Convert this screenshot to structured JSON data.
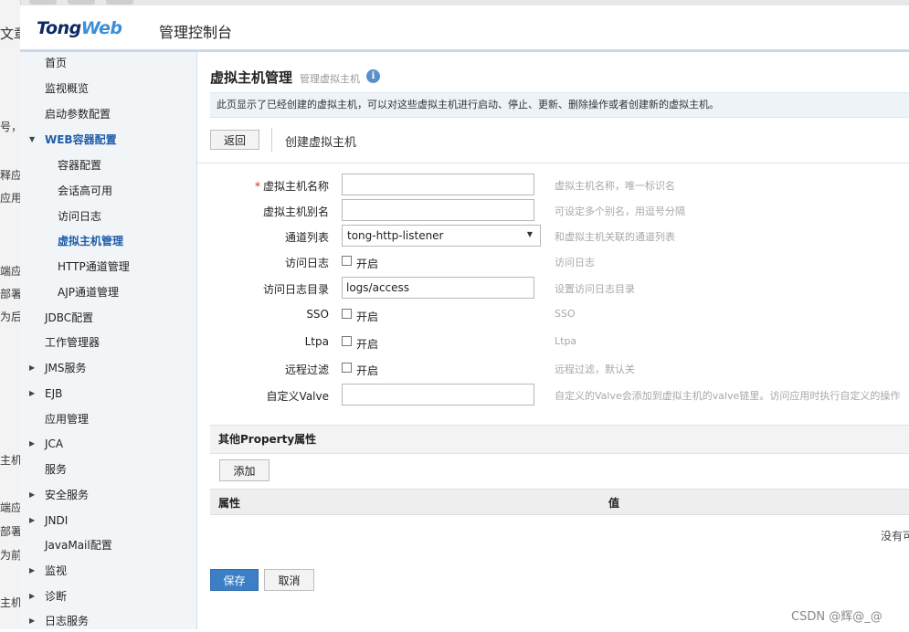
{
  "background_fragments": [
    "文章",
    "号，",
    "释应",
    "应用",
    "端应",
    "部署",
    "为后",
    "主机",
    "端应",
    "部署",
    "为前",
    "主机"
  ],
  "header": {
    "logo_part1": "Tong",
    "logo_part2": "Web",
    "title": "管理控制台"
  },
  "sidebar": {
    "items": [
      {
        "label": "首页",
        "level": 1,
        "arrow": ""
      },
      {
        "label": "监视概览",
        "level": 1,
        "arrow": ""
      },
      {
        "label": "启动参数配置",
        "level": 1,
        "arrow": ""
      },
      {
        "label": "WEB容器配置",
        "level": 1,
        "arrow": "▼"
      },
      {
        "label": "容器配置",
        "level": 2,
        "arrow": ""
      },
      {
        "label": "会话高可用",
        "level": 2,
        "arrow": ""
      },
      {
        "label": "访问日志",
        "level": 2,
        "arrow": ""
      },
      {
        "label": "虚拟主机管理",
        "level": 2,
        "arrow": ""
      },
      {
        "label": "HTTP通道管理",
        "level": 2,
        "arrow": ""
      },
      {
        "label": "AJP通道管理",
        "level": 2,
        "arrow": ""
      },
      {
        "label": "JDBC配置",
        "level": 1,
        "arrow": ""
      },
      {
        "label": "工作管理器",
        "level": 1,
        "arrow": ""
      },
      {
        "label": "JMS服务",
        "level": 1,
        "arrow": "▶"
      },
      {
        "label": "EJB",
        "level": 1,
        "arrow": "▶"
      },
      {
        "label": "应用管理",
        "level": 1,
        "arrow": ""
      },
      {
        "label": "JCA",
        "level": 1,
        "arrow": "▶"
      },
      {
        "label": "服务",
        "level": 1,
        "arrow": ""
      },
      {
        "label": "安全服务",
        "level": 1,
        "arrow": "▶"
      },
      {
        "label": "JNDI",
        "level": 1,
        "arrow": "▶"
      },
      {
        "label": "JavaMail配置",
        "level": 1,
        "arrow": ""
      },
      {
        "label": "监视",
        "level": 1,
        "arrow": "▶"
      },
      {
        "label": "诊断",
        "level": 1,
        "arrow": "▶"
      },
      {
        "label": "日志服务",
        "level": 1,
        "arrow": "▶"
      }
    ]
  },
  "main": {
    "title": "虚拟主机管理",
    "subtitle": "管理虚拟主机",
    "info_icon": "i",
    "description": "此页显示了已经创建的虚拟主机，可以对这些虚拟主机进行启动、停止、更新、删除操作或者创建新的虚拟主机。",
    "back_label": "返回",
    "create_title": "创建虚拟主机",
    "form": {
      "required_mark": "*",
      "name_label": "虚拟主机名称",
      "name_value": "",
      "name_hint": "虚拟主机名称，唯一标识名",
      "alias_label": "虚拟主机别名",
      "alias_value": "",
      "alias_hint": "可设定多个别名，用逗号分隔",
      "channel_label": "通道列表",
      "channel_value": "tong-http-listener",
      "channel_hint": "和虚拟主机关联的通道列表",
      "access_log_label": "访问日志",
      "access_log_check": "开启",
      "access_log_hint": "访问日志",
      "log_dir_label": "访问日志目录",
      "log_dir_value": "logs/access",
      "log_dir_hint": "设置访问日志目录",
      "sso_label": "SSO",
      "sso_check": "开启",
      "sso_hint": "SSO",
      "ltpa_label": "Ltpa",
      "ltpa_check": "开启",
      "ltpa_hint": "Ltpa",
      "remote_label": "远程过滤",
      "remote_check": "开启",
      "remote_hint": "远程过滤，默认关",
      "valve_label": "自定义Valve",
      "valve_value": "",
      "valve_hint": "自定义的Valve会添加到虚拟主机的valve链里。访问应用时执行自定义的操作"
    },
    "property_section": "其他Property属性",
    "add_label": "添加",
    "table_headers": [
      "属性",
      "值"
    ],
    "no_data": "没有可",
    "save_label": "保存",
    "cancel_label": "取消"
  },
  "watermark": "CSDN @辉@_@"
}
